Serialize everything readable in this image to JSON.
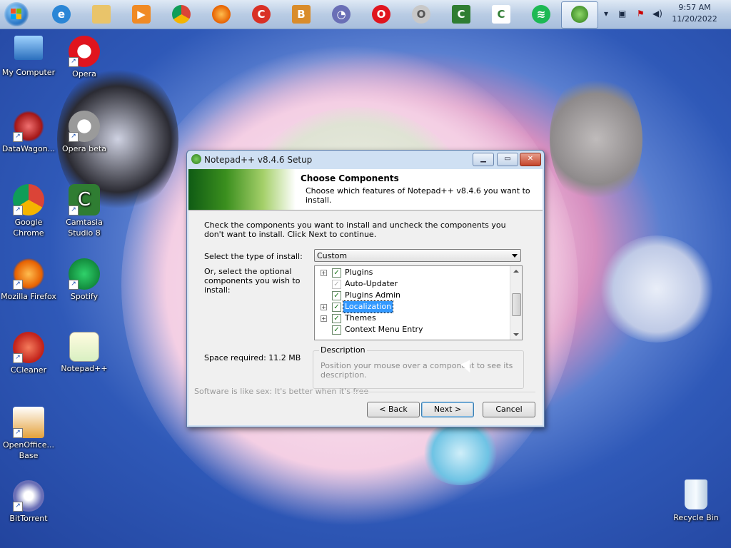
{
  "taskbar": {
    "icons": [
      "windows-start",
      "internet-explorer",
      "file-explorer",
      "media-player",
      "chrome",
      "firefox",
      "ccleaner",
      "openoffice-base",
      "bittorrent",
      "opera",
      "opera-beta",
      "camtasia",
      "camtasia-2",
      "spotify",
      "notepad-plus-plus-setup"
    ],
    "clock_time": "9:57 AM",
    "clock_date": "11/20/2022"
  },
  "desktop": {
    "icons": [
      {
        "label": "My Computer"
      },
      {
        "label": "Opera"
      },
      {
        "label": "DataWagon..."
      },
      {
        "label": "Opera beta"
      },
      {
        "label": "Google Chrome"
      },
      {
        "label": "Camtasia Studio 8"
      },
      {
        "label": "Mozilla Firefox"
      },
      {
        "label": "Spotify"
      },
      {
        "label": "CCleaner"
      },
      {
        "label": "Notepad++"
      },
      {
        "label": "OpenOffice... Base"
      },
      {
        "label": "BitTorrent"
      },
      {
        "label": "Recycle Bin"
      }
    ]
  },
  "dialog": {
    "title": "Notepad++ v8.4.6 Setup",
    "header_title": "Choose Components",
    "header_subtitle": "Choose which features of Notepad++ v8.4.6 you want to install.",
    "intro": "Check the components you want to install and uncheck the components you don't want to install. Click Next to continue.",
    "install_type_label": "Select the type of install:",
    "install_type_value": "Custom",
    "optional_label": "Or, select the optional components you wish to install:",
    "components": [
      {
        "label": "Plugins",
        "expandable": true,
        "checked": true
      },
      {
        "label": "Auto-Updater",
        "expandable": false,
        "checked": true,
        "disabled": true
      },
      {
        "label": "Plugins Admin",
        "expandable": false,
        "checked": true
      },
      {
        "label": "Localization",
        "expandable": true,
        "checked": true,
        "selected": true
      },
      {
        "label": "Themes",
        "expandable": true,
        "checked": true
      },
      {
        "label": "Context Menu Entry",
        "expandable": false,
        "checked": true
      }
    ],
    "space_required": "Space required: 11.2 MB",
    "description_legend": "Description",
    "description_text": "Position your mouse over a component to see its description.",
    "branding": "Software is like sex: It's better when it's free",
    "back_label": "< Back",
    "next_label": "Next >",
    "cancel_label": "Cancel"
  }
}
